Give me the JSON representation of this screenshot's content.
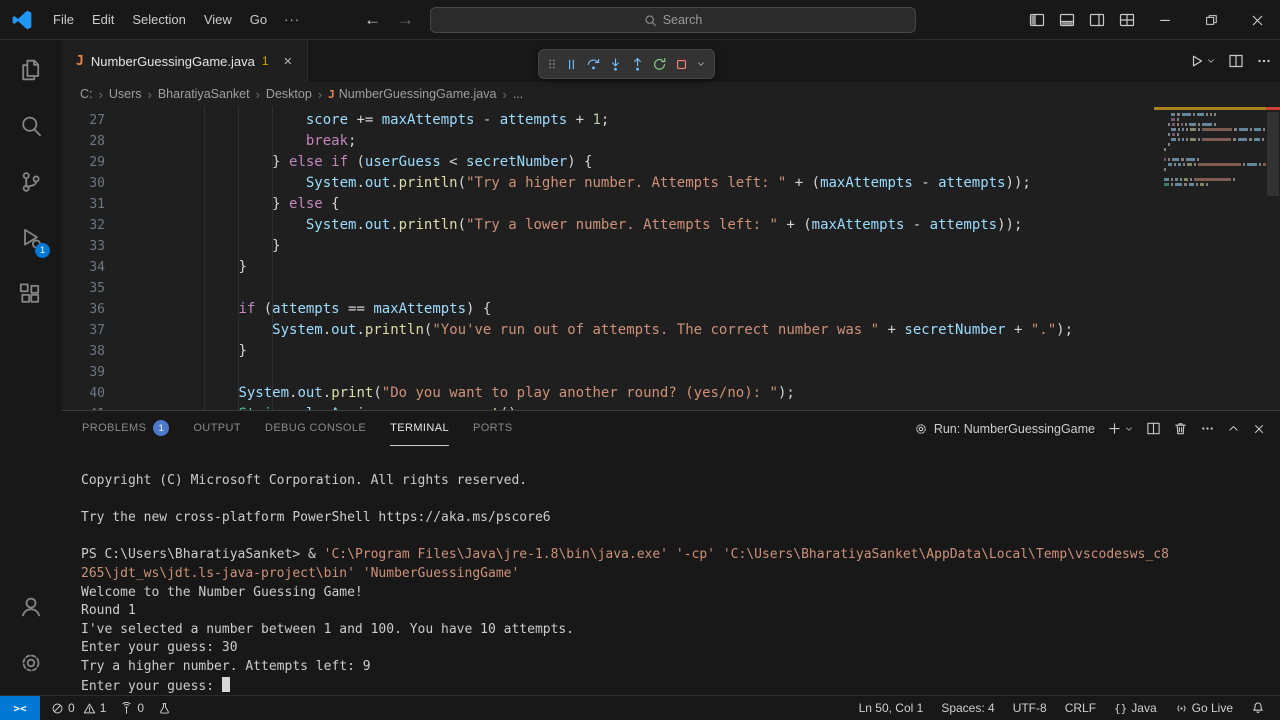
{
  "colors": {
    "accent": "#0078d4",
    "shell_bg": "#181818",
    "editor_bg": "#1f1f1f",
    "statusbar_remote": "#0078d4",
    "keyword": "#c586c0",
    "variable": "#9cdcfe",
    "function": "#dcdcaa",
    "string": "#ce9178",
    "number": "#b5cea8",
    "type": "#4ec9b0",
    "operator": "#d4d4d4",
    "terminal_path": "#ce9178",
    "java_icon": "#e8884a",
    "warning": "#cca700",
    "error": "#f14c4c",
    "debug_blue": "#75beff",
    "debug_green": "#89d185",
    "debug_red": "#f48771"
  },
  "titlebar": {
    "menus": [
      "File",
      "Edit",
      "Selection",
      "View",
      "Go"
    ],
    "more_label": "···",
    "search_placeholder": "Search"
  },
  "editor": {
    "tab": {
      "file": "NumberGuessingGame.java",
      "problem_badge": "1"
    },
    "breadcrumb": [
      "C:",
      "Users",
      "BharatiyaSanket",
      "Desktop",
      "NumberGuessingGame.java",
      "..."
    ],
    "lines": [
      {
        "n": 27,
        "i": 16,
        "tk": [
          [
            "score",
            "v"
          ],
          [
            " += ",
            "o"
          ],
          [
            "maxAttempts",
            "v"
          ],
          [
            " - ",
            "o"
          ],
          [
            "attempts",
            "v"
          ],
          [
            " + ",
            "o"
          ],
          [
            "1",
            "n"
          ],
          [
            ";",
            "o"
          ]
        ]
      },
      {
        "n": 28,
        "i": 16,
        "tk": [
          [
            "break",
            "k"
          ],
          [
            ";",
            "o"
          ]
        ]
      },
      {
        "n": 29,
        "i": 12,
        "tk": [
          [
            "} ",
            "o"
          ],
          [
            "else",
            "k"
          ],
          [
            " ",
            "o"
          ],
          [
            "if",
            "k"
          ],
          [
            " (",
            "o"
          ],
          [
            "userGuess",
            "v"
          ],
          [
            " < ",
            "o"
          ],
          [
            "secretNumber",
            "v"
          ],
          [
            ") {",
            "o"
          ]
        ]
      },
      {
        "n": 30,
        "i": 16,
        "tk": [
          [
            "System",
            "v"
          ],
          [
            ".",
            "o"
          ],
          [
            "out",
            "v"
          ],
          [
            ".",
            "o"
          ],
          [
            "println",
            "f"
          ],
          [
            "(",
            "o"
          ],
          [
            "\"Try a higher number. Attempts left: \"",
            "s"
          ],
          [
            " + (",
            "o"
          ],
          [
            "maxAttempts",
            "v"
          ],
          [
            " - ",
            "o"
          ],
          [
            "attempts",
            "v"
          ],
          [
            "));",
            "o"
          ]
        ]
      },
      {
        "n": 31,
        "i": 12,
        "tk": [
          [
            "} ",
            "o"
          ],
          [
            "else",
            "k"
          ],
          [
            " {",
            "o"
          ]
        ]
      },
      {
        "n": 32,
        "i": 16,
        "tk": [
          [
            "System",
            "v"
          ],
          [
            ".",
            "o"
          ],
          [
            "out",
            "v"
          ],
          [
            ".",
            "o"
          ],
          [
            "println",
            "f"
          ],
          [
            "(",
            "o"
          ],
          [
            "\"Try a lower number. Attempts left: \"",
            "s"
          ],
          [
            " + (",
            "o"
          ],
          [
            "maxAttempts",
            "v"
          ],
          [
            " - ",
            "o"
          ],
          [
            "attempts",
            "v"
          ],
          [
            "));",
            "o"
          ]
        ]
      },
      {
        "n": 33,
        "i": 12,
        "tk": [
          [
            "}",
            "o"
          ]
        ]
      },
      {
        "n": 34,
        "i": 8,
        "tk": [
          [
            "}",
            "o"
          ]
        ]
      },
      {
        "n": 35,
        "i": 0,
        "tk": []
      },
      {
        "n": 36,
        "i": 8,
        "tk": [
          [
            "if",
            "k"
          ],
          [
            " (",
            "o"
          ],
          [
            "attempts",
            "v"
          ],
          [
            " == ",
            "o"
          ],
          [
            "maxAttempts",
            "v"
          ],
          [
            ") {",
            "o"
          ]
        ]
      },
      {
        "n": 37,
        "i": 12,
        "tk": [
          [
            "System",
            "v"
          ],
          [
            ".",
            "o"
          ],
          [
            "out",
            "v"
          ],
          [
            ".",
            "o"
          ],
          [
            "println",
            "f"
          ],
          [
            "(",
            "o"
          ],
          [
            "\"You've run out of attempts. The correct number was \"",
            "s"
          ],
          [
            " + ",
            "o"
          ],
          [
            "secretNumber",
            "v"
          ],
          [
            " + ",
            "o"
          ],
          [
            "\".\"",
            "s"
          ],
          [
            ");",
            "o"
          ]
        ]
      },
      {
        "n": 38,
        "i": 8,
        "tk": [
          [
            "}",
            "o"
          ]
        ]
      },
      {
        "n": 39,
        "i": 0,
        "tk": []
      },
      {
        "n": 40,
        "i": 8,
        "tk": [
          [
            "System",
            "v"
          ],
          [
            ".",
            "o"
          ],
          [
            "out",
            "v"
          ],
          [
            ".",
            "o"
          ],
          [
            "print",
            "f"
          ],
          [
            "(",
            "o"
          ],
          [
            "\"Do you want to play another round? (yes/no): \"",
            "s"
          ],
          [
            ");",
            "o"
          ]
        ]
      },
      {
        "n": 41,
        "i": 8,
        "tk": [
          [
            "String",
            "t"
          ],
          [
            " ",
            "o"
          ],
          [
            "playAgain",
            "v"
          ],
          [
            " = ",
            "o"
          ],
          [
            "scanner",
            "v"
          ],
          [
            ".",
            "o"
          ],
          [
            "next",
            "f"
          ],
          [
            "();",
            "o"
          ]
        ]
      }
    ]
  },
  "panel": {
    "tabs": [
      {
        "label": "PROBLEMS",
        "badge": "1"
      },
      {
        "label": "OUTPUT"
      },
      {
        "label": "DEBUG CONSOLE"
      },
      {
        "label": "TERMINAL"
      },
      {
        "label": "PORTS"
      }
    ],
    "active_tab": "TERMINAL",
    "run_label": "Run: NumberGuessingGame",
    "terminal": [
      [
        [
          "Copyright (C) Microsoft Corporation. All rights reserved.",
          "d"
        ]
      ],
      [],
      [
        [
          "Try the new cross-platform PowerShell https://aka.ms/pscore6",
          "d"
        ]
      ],
      [],
      [
        [
          "PS C:\\Users\\BharatiyaSanket> & ",
          "d"
        ],
        [
          "'C:\\Program Files\\Java\\jre-1.8\\bin\\java.exe'",
          "p"
        ],
        [
          " ",
          "d"
        ],
        [
          "'-cp'",
          "p"
        ],
        [
          " ",
          "d"
        ],
        [
          "'C:\\Users\\BharatiyaSanket\\AppData\\Local\\Temp\\vscodesws_c8",
          "p"
        ]
      ],
      [
        [
          "265\\jdt_ws\\jdt.ls-java-project\\bin'",
          "p"
        ],
        [
          " ",
          "d"
        ],
        [
          "'NumberGuessingGame'",
          "p"
        ]
      ],
      [
        [
          "Welcome to the Number Guessing Game!",
          "d"
        ]
      ],
      [
        [
          "Round 1",
          "d"
        ]
      ],
      [
        [
          "I've selected a number between 1 and 100. You have 10 attempts.",
          "d"
        ]
      ],
      [
        [
          "Enter your guess: 30",
          "d"
        ]
      ],
      [
        [
          "Try a higher number. Attempts left: 9",
          "d"
        ]
      ],
      [
        [
          "Enter your guess: ",
          "d"
        ]
      ]
    ]
  },
  "status": {
    "errors": "0",
    "warnings": "1",
    "ports": "0",
    "line_col": "Ln 50, Col 1",
    "indent": "Spaces: 4",
    "encoding": "UTF-8",
    "eol": "CRLF",
    "lang_icon": "{}",
    "language": "Java",
    "go_live": "Go Live"
  }
}
